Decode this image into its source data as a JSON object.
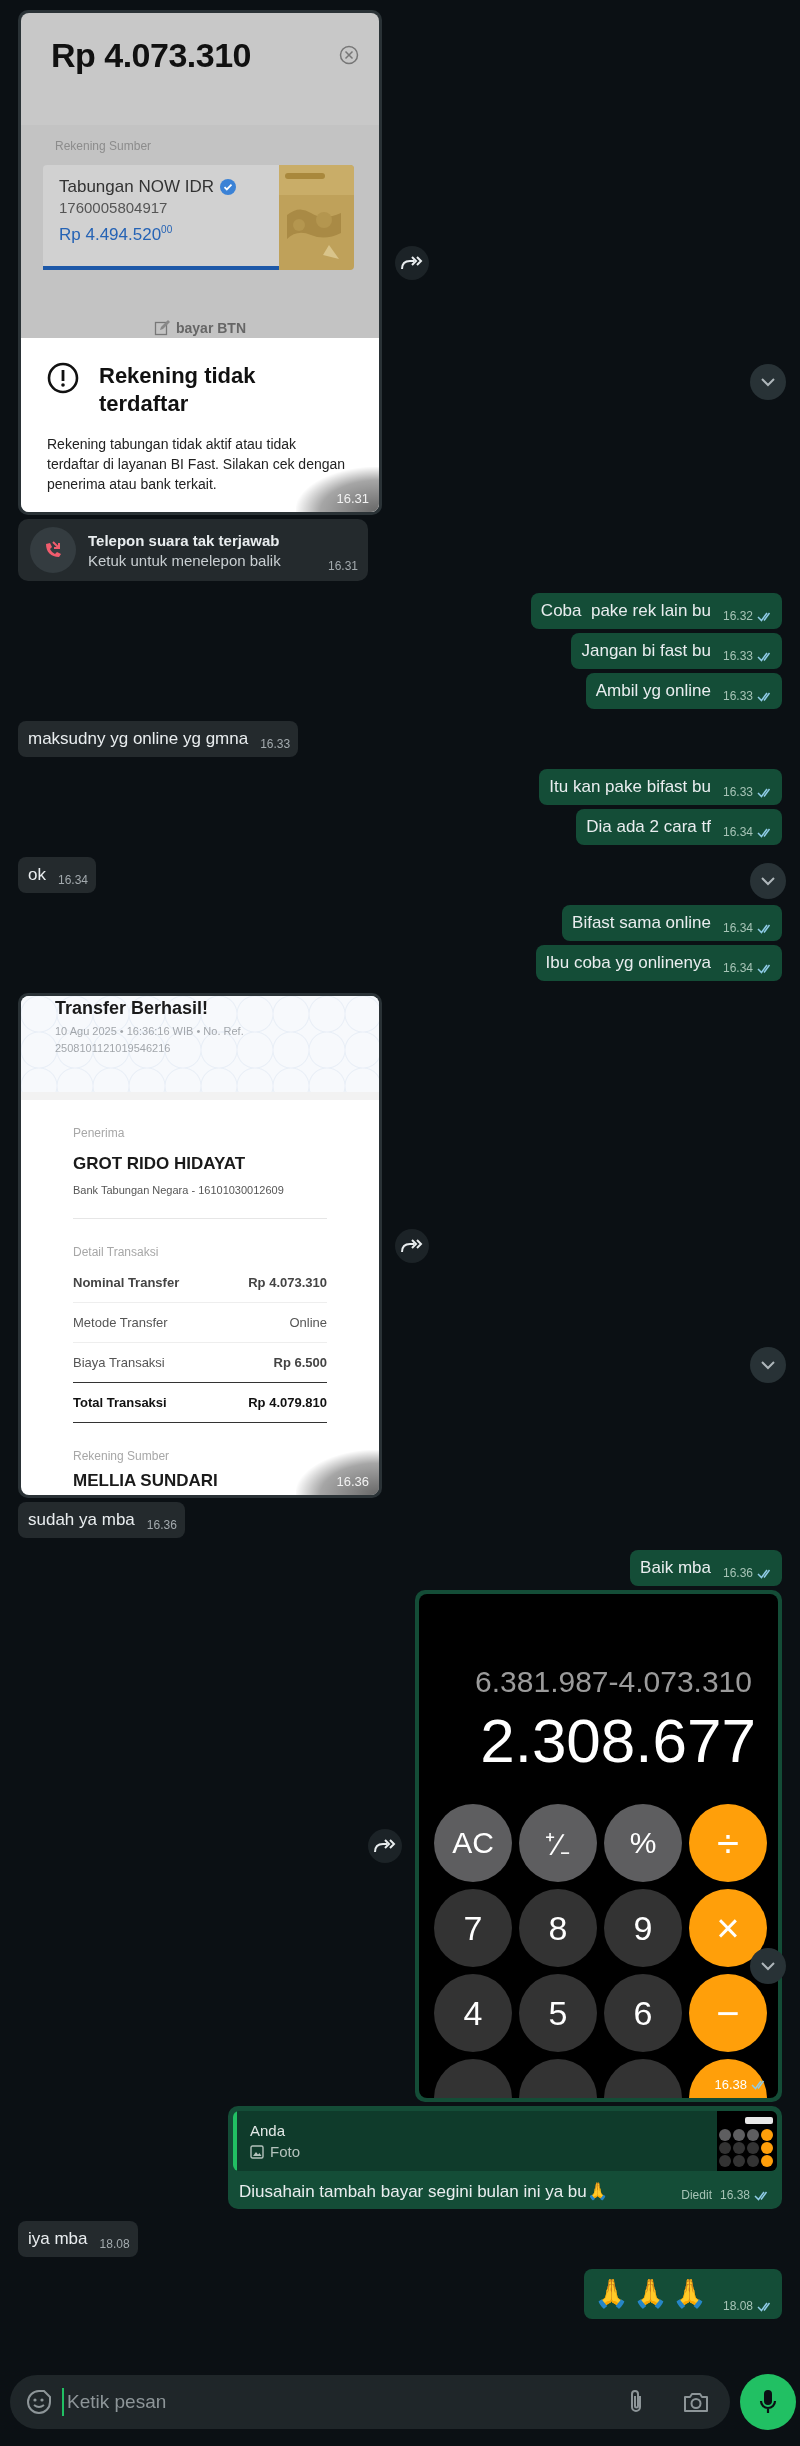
{
  "messages": [
    {
      "kind": "bank_error",
      "outgoing": false,
      "forward_button": true,
      "scroll_button": true,
      "time": "16.31",
      "amount": "Rp 4.073.310",
      "source_label": "Rekening Sumber",
      "account_name": "Tabungan NOW IDR",
      "account_number": "1760005804917",
      "balance": "Rp 4.494.520$^{00}$",
      "action": "bayar BTN",
      "dialog_title": "Rekening tidak terdaftar",
      "dialog_body": "Rekening tabungan tidak aktif atau tidak terdaftar di layanan BI Fast. Silakan cek dengan penerima atau bank terkait."
    },
    {
      "kind": "call",
      "outgoing": false,
      "title": "Telepon suara tak terjawab",
      "subtitle": "Ketuk untuk menelepon balik",
      "time": "16.31"
    },
    {
      "kind": "text",
      "outgoing": true,
      "text": "Coba  pake rek lain bu",
      "time": "16.32",
      "read": true
    },
    {
      "kind": "text",
      "outgoing": true,
      "text": "Jangan bi fast bu",
      "time": "16.33",
      "read": true
    },
    {
      "kind": "text",
      "outgoing": true,
      "text": "Ambil yg online",
      "time": "16.33",
      "read": true
    },
    {
      "kind": "text",
      "outgoing": false,
      "text": "maksudny yg online yg gmna",
      "time": "16.33"
    },
    {
      "kind": "text",
      "outgoing": true,
      "text": "Itu kan pake bifast bu",
      "time": "16.33",
      "read": true
    },
    {
      "kind": "text",
      "outgoing": true,
      "text": "Dia ada 2 cara tf",
      "time": "16.34",
      "read": true
    },
    {
      "kind": "text",
      "outgoing": false,
      "text": "ok",
      "time": "16.34",
      "scroll_button": true
    },
    {
      "kind": "text",
      "outgoing": true,
      "text": "Bifast sama online",
      "time": "16.34",
      "read": true
    },
    {
      "kind": "text",
      "outgoing": true,
      "text": "Ibu coba yg onlinenya",
      "time": "16.34",
      "read": true
    },
    {
      "kind": "receipt",
      "outgoing": false,
      "forward_button": true,
      "scroll_button": true,
      "time": "16.36",
      "title": "Transfer Berhasil!",
      "meta": "10 Agu 2025 • 16:36:16 WIB • No. Ref. 2508101121019546216",
      "recipient_label": "Penerima",
      "recipient_name": "GROT RIDO HIDAYAT",
      "recipient_bank": "Bank Tabungan Negara - 16101030012609",
      "details_label": "Detail Transaksi",
      "rows": [
        {
          "kind": "detail",
          "label": "Nominal Transfer",
          "value": "Rp 4.073.310",
          "label_bold": true,
          "value_bold": true
        },
        {
          "kind": "detail",
          "label": "Metode Transfer",
          "value": "Online",
          "label_bold": false,
          "value_bold": false
        },
        {
          "kind": "detail",
          "label": "Biaya Transaksi",
          "value": "Rp 6.500",
          "label_bold": false,
          "value_bold": true
        },
        {
          "kind": "total",
          "label": "Total Transaksi",
          "value": "Rp 4.079.810",
          "label_bold": true,
          "value_bold": true
        }
      ],
      "source_label": "Rekening Sumber",
      "source_name": "MELLIA SUNDARI"
    },
    {
      "kind": "text",
      "outgoing": false,
      "text": "sudah ya mba",
      "time": "16.36"
    },
    {
      "kind": "text",
      "outgoing": true,
      "text": "Baik mba",
      "time": "16.36",
      "read": true
    },
    {
      "kind": "calculator",
      "outgoing": true,
      "forward_button": true,
      "scroll_button": true,
      "time": "16.38",
      "read": true,
      "expression": "6.381.987-4.073.310",
      "result": "2.308.677",
      "keys": [
        {
          "kind": "function",
          "label": "AC"
        },
        {
          "kind": "function",
          "label": "⁺∕₋"
        },
        {
          "kind": "function",
          "label": "%"
        },
        {
          "kind": "operator",
          "label": "÷"
        },
        {
          "kind": "digit",
          "label": "7"
        },
        {
          "kind": "digit",
          "label": "8"
        },
        {
          "kind": "digit",
          "label": "9"
        },
        {
          "kind": "operator",
          "label": "×"
        },
        {
          "kind": "digit",
          "label": "4"
        },
        {
          "kind": "digit",
          "label": "5"
        },
        {
          "kind": "digit",
          "label": "6"
        },
        {
          "kind": "operator",
          "label": "−"
        },
        {
          "kind": "digit"
        },
        {
          "kind": "digit"
        },
        {
          "kind": "digit"
        },
        {
          "kind": "operator"
        }
      ]
    },
    {
      "kind": "reply",
      "outgoing": true,
      "quote_author": "Anda",
      "quote_label": "Foto",
      "text": "Diusahain tambah bayar segini bulan ini ya bu🙏",
      "edited": "Diedit",
      "time": "16.38",
      "read": true
    },
    {
      "kind": "text",
      "outgoing": false,
      "text": "iya mba",
      "time": "18.08"
    },
    {
      "kind": "emoji",
      "outgoing": true,
      "text": "🙏🙏🙏",
      "time": "18.08",
      "read": true
    }
  ],
  "composer": {
    "placeholder": "Ketik pesan"
  }
}
